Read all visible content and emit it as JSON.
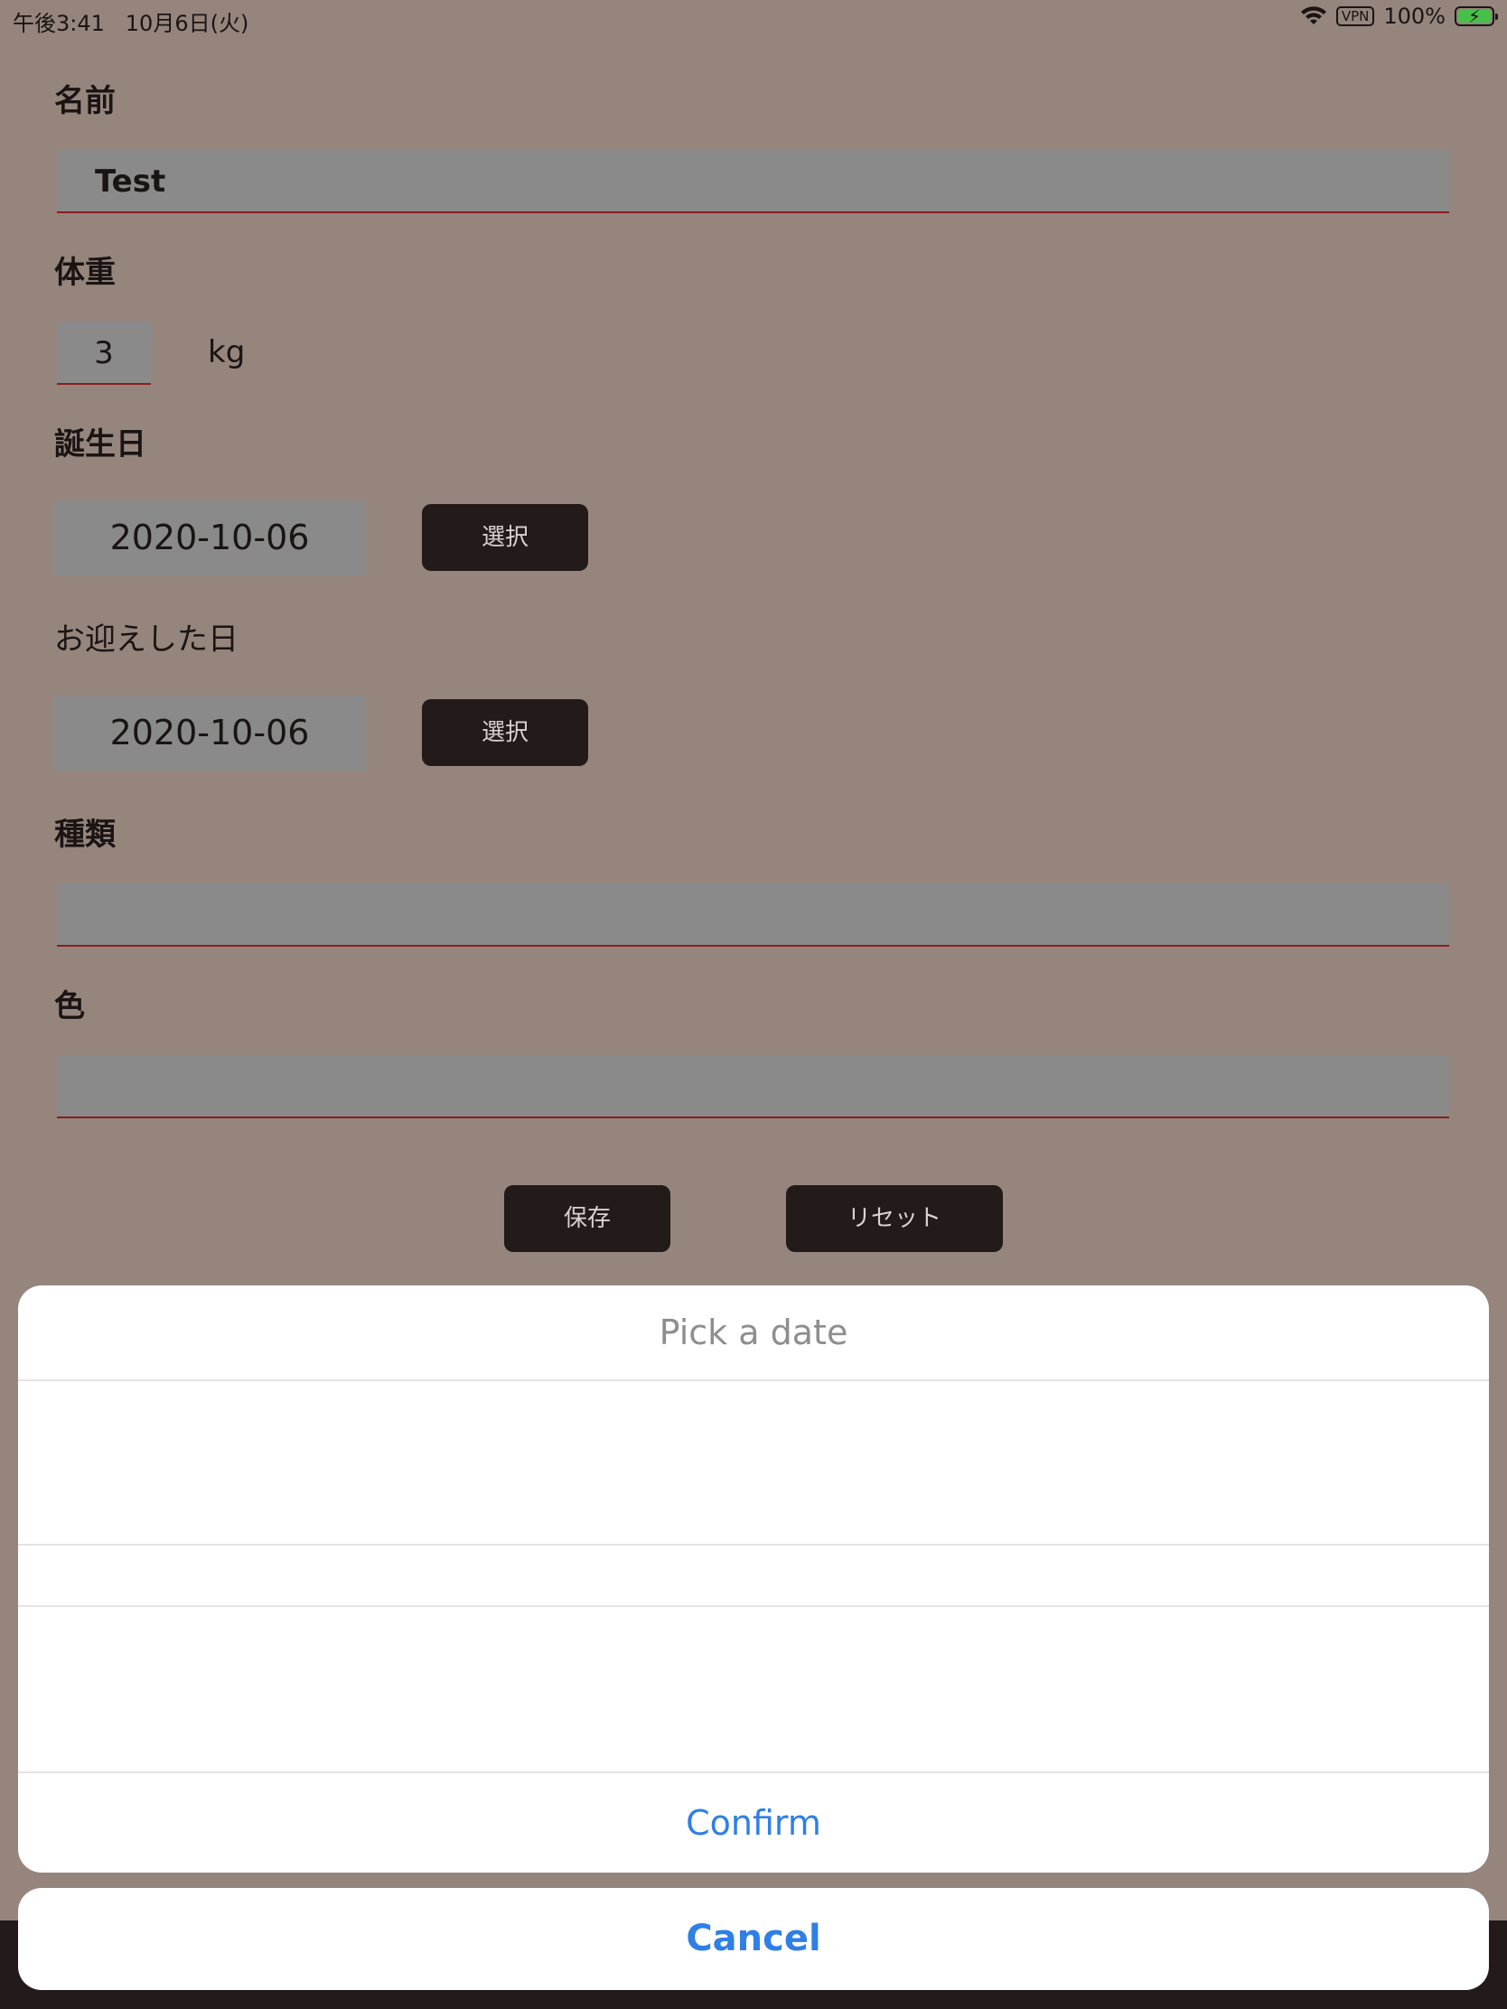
{
  "status_bar": {
    "time_date": "午後3:41   10月6日(火)",
    "vpn": "VPN",
    "battery": "100%",
    "wifi_icon": "wifi-icon",
    "battery_icon": "battery-charging-icon"
  },
  "form": {
    "name": {
      "label": "名前",
      "value": "Test"
    },
    "weight": {
      "label": "体重",
      "value": "3",
      "unit": "kg"
    },
    "birthday": {
      "label": "誕生日",
      "value": "2020-10-06",
      "button": "選択"
    },
    "welcome_day": {
      "label": "お迎えした日",
      "value": "2020-10-06",
      "button": "選択"
    },
    "breed": {
      "label": "種類",
      "value": ""
    },
    "color": {
      "label": "色",
      "value": ""
    },
    "save_button": "保存",
    "reset_button": "リセット"
  },
  "date_picker": {
    "title": "Pick a date",
    "confirm": "Confirm",
    "cancel": "Cancel"
  },
  "colors": {
    "background": "#95857d",
    "input_fill": "#8a8a8a",
    "underline": "#8c1c1c",
    "button_dark": "#231a1a",
    "accent": "#2f7fe6"
  }
}
